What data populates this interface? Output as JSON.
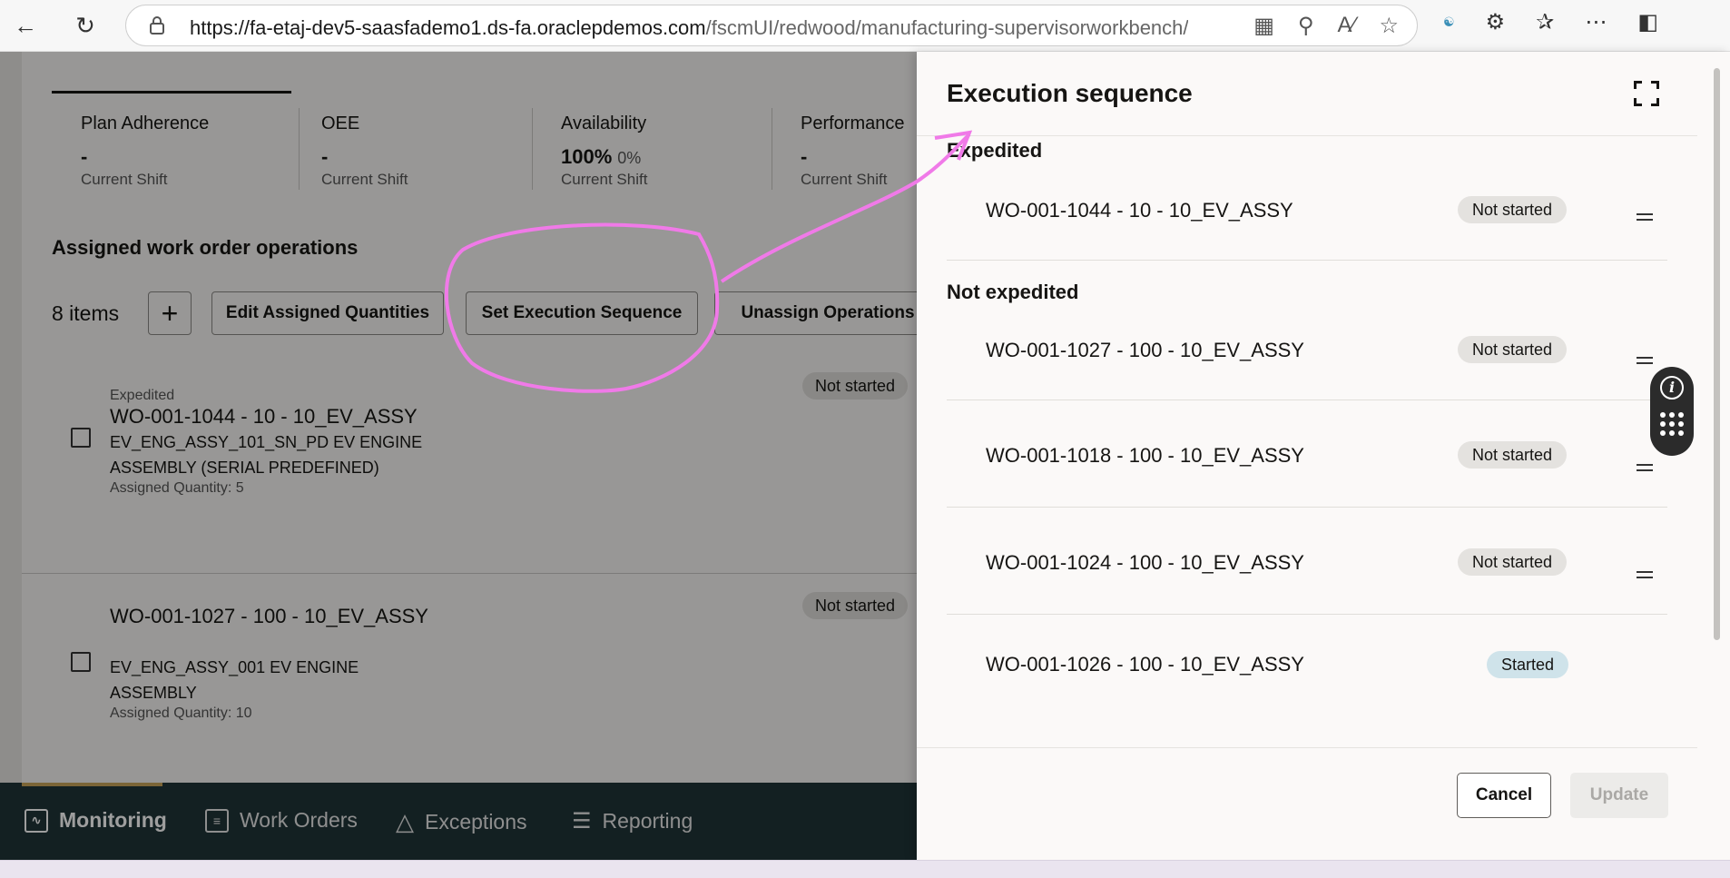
{
  "browser": {
    "url_host": "https://fa-etaj-dev5-saasfademo1.ds-fa.oraclepdemos.com",
    "url_path": "/fscmUI/redwood/manufacturing-supervisorworkbench/p..."
  },
  "metrics": [
    {
      "title": "Plan Adherence",
      "value": "-",
      "sub": "",
      "foot": "Current Shift"
    },
    {
      "title": "OEE",
      "value": "-",
      "sub": "",
      "foot": "Current Shift"
    },
    {
      "title": "Availability",
      "value": "100%",
      "sub": "0%",
      "foot": "Current Shift"
    },
    {
      "title": "Performance",
      "value": "-",
      "sub": "",
      "foot": "Current Shift"
    }
  ],
  "operations": {
    "section_title": "Assigned work order operations",
    "items_count": "8 items",
    "add_label": "+",
    "edit_quantities_label": "Edit Assigned Quantities",
    "set_sequence_label": "Set Execution Sequence",
    "unassign_label": "Unassign Operations",
    "cards": [
      {
        "priority": "Expedited",
        "title": "WO-001-1044 - 10 - 10_EV_ASSY",
        "description": "EV_ENG_ASSY_101_SN_PD EV ENGINE ASSEMBLY (SERIAL PREDEFINED)",
        "quantity": "Assigned Quantity: 5",
        "status": "Not started"
      },
      {
        "priority": "",
        "title": "WO-001-1027 - 100 - 10_EV_ASSY",
        "description": "EV_ENG_ASSY_001 EV ENGINE ASSEMBLY",
        "quantity": "Assigned Quantity: 10",
        "status": "Not started"
      }
    ]
  },
  "bottom_nav": {
    "items": [
      {
        "label": "Monitoring",
        "icon": "monitor-icon"
      },
      {
        "label": "Work Orders",
        "icon": "document-icon"
      },
      {
        "label": "Exceptions",
        "icon": "warning-icon"
      },
      {
        "label": "Reporting",
        "icon": "report-icon"
      }
    ],
    "active": "Monitoring",
    "accent_color": "#c7a45a"
  },
  "drawer": {
    "title": "Execution sequence",
    "expedited_heading": "Expedited",
    "not_expedited_heading": "Not expedited",
    "expedited": [
      {
        "label": "WO-001-1044 - 10 - 10_EV_ASSY",
        "status": "Not started"
      }
    ],
    "not_expedited": [
      {
        "label": "WO-001-1027 - 100 - 10_EV_ASSY",
        "status": "Not started"
      },
      {
        "label": "WO-001-1018 - 100 - 10_EV_ASSY",
        "status": "Not started"
      },
      {
        "label": "WO-001-1024 - 100 - 10_EV_ASSY",
        "status": "Not started"
      },
      {
        "label": "WO-001-1026 - 100 - 10_EV_ASSY",
        "status": "Started"
      }
    ],
    "cancel_label": "Cancel",
    "update_label": "Update"
  },
  "colors": {
    "annotation": "#f07ae8",
    "started_badge": "#cfe3ea",
    "nav_background": "#1f3438"
  }
}
